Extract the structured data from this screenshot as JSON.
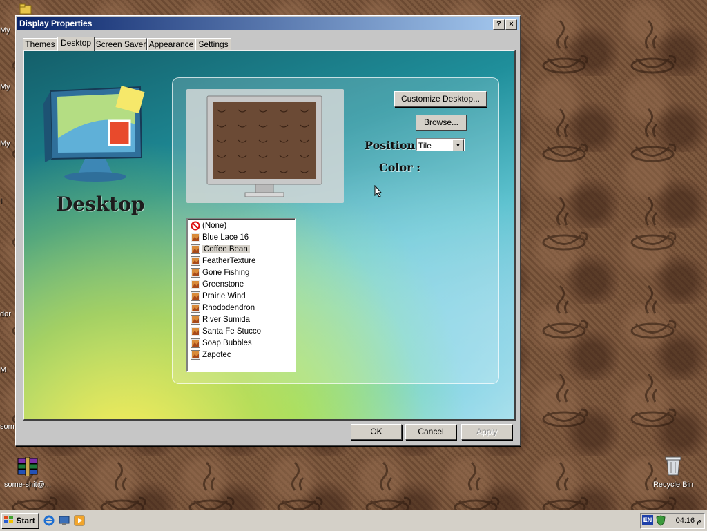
{
  "window": {
    "title": "Display Properties",
    "help_label": "?",
    "close_label": "×"
  },
  "tabs": [
    {
      "label": "Themes"
    },
    {
      "label": "Desktop"
    },
    {
      "label": "Screen Saver"
    },
    {
      "label": "Appearance"
    },
    {
      "label": "Settings"
    }
  ],
  "active_tab": "Desktop",
  "panel": {
    "heading": "Desktop",
    "customize_label": "Customize Desktop...",
    "browse_label": "Browse...",
    "position_label": "Position :",
    "position_value": "Tile",
    "color_label": "Color :"
  },
  "backgrounds": [
    {
      "label": "(None)",
      "icon": "none-icon"
    },
    {
      "label": "Blue Lace 16",
      "icon": "image-icon"
    },
    {
      "label": "Coffee Bean",
      "icon": "image-icon",
      "selected": true
    },
    {
      "label": "FeatherTexture",
      "icon": "image-icon"
    },
    {
      "label": "Gone Fishing",
      "icon": "image-icon"
    },
    {
      "label": "Greenstone",
      "icon": "image-icon"
    },
    {
      "label": "Prairie Wind",
      "icon": "image-icon"
    },
    {
      "label": "Rhododendron",
      "icon": "image-icon"
    },
    {
      "label": "River Sumida",
      "icon": "image-icon"
    },
    {
      "label": "Santa Fe Stucco",
      "icon": "image-icon"
    },
    {
      "label": "Soap Bubbles",
      "icon": "image-icon"
    },
    {
      "label": "Zapotec",
      "icon": "image-icon"
    }
  ],
  "buttons": {
    "ok": "OK",
    "cancel": "Cancel",
    "apply": "Apply"
  },
  "desktop_icons": {
    "side_labels": [
      "My",
      "My",
      "My",
      "I",
      "dor",
      "M",
      "som"
    ],
    "winrar_label": "some-shit@...",
    "recycle_label": "Recycle Bin"
  },
  "taskbar": {
    "start_label": "Start",
    "lang": "EN",
    "clock": "04:16 م"
  },
  "colors": {
    "title_start": "#0a246a",
    "title_end": "#a6caf0",
    "face": "#d4d0c8"
  }
}
